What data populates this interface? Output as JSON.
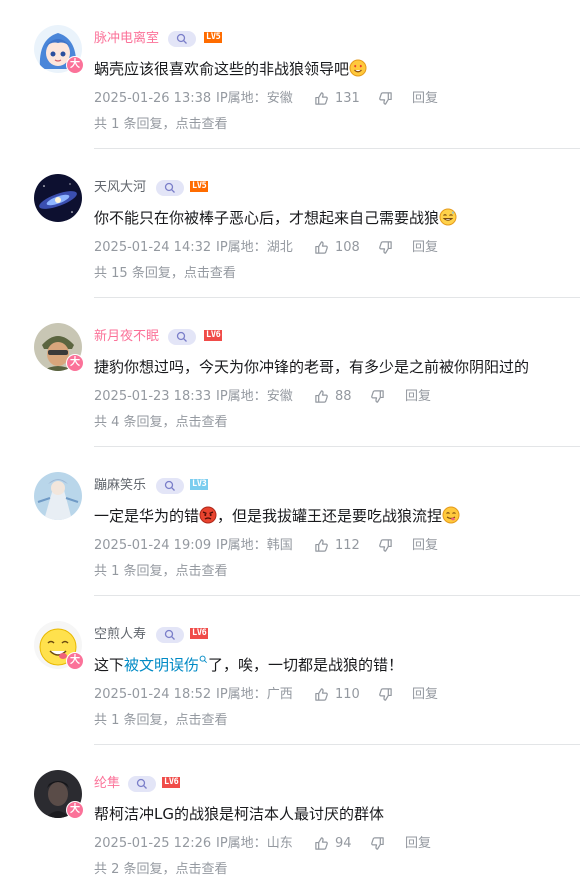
{
  "labels": {
    "ip_prefix": "IP属地：",
    "reply": "回复",
    "replies_prefix": "共 ",
    "replies_suffix": " 条回复，点击查看",
    "vip_badge": "大"
  },
  "comments": [
    {
      "username": "脉冲电离室",
      "level": "LV5",
      "text": "蜗壳应该很喜欢俞这些的非战狼领导吧",
      "emoji": "heart-eyes-emoji",
      "date": "2025-01-26 13:38",
      "ip": "安徽",
      "likes": "131",
      "reply_count": "1"
    },
    {
      "username": "天风大河",
      "level": "LV5",
      "text": "你不能只在你被棒子恶心后，才想起来自己需要战狼",
      "emoji": "sweat-smile-emoji",
      "date": "2025-01-24 14:32",
      "ip": "湖北",
      "likes": "108",
      "reply_count": "15"
    },
    {
      "username": "新月夜不眠",
      "level": "LV6",
      "text": "捷豹你想过吗，今天为你冲锋的老哥，有多少是之前被你阴阳过的",
      "date": "2025-01-23 18:33",
      "ip": "安徽",
      "likes": "88",
      "reply_count": "4"
    },
    {
      "username": "蹦麻笑乐",
      "level": "LV3",
      "text_before": "一定是华为的错",
      "text_after": "，但是我拔罐王还是要吃战狼流捏",
      "emoji_mid": "angry-emoji",
      "emoji": "yum-emoji",
      "date": "2025-01-24 19:09",
      "ip": "韩国",
      "likes": "112",
      "reply_count": "1"
    },
    {
      "username": "空煎人寿",
      "level": "LV6",
      "text_before": "这下",
      "link": "被文明误伤",
      "text_after": "了，唉，一切都是战狼的错！",
      "date": "2025-01-24 18:52",
      "ip": "广西",
      "likes": "110",
      "reply_count": "1"
    },
    {
      "username": "纶隼",
      "level": "LV6",
      "text": "帮柯洁冲LG的战狼是柯洁本人最讨厌的群体",
      "date": "2025-01-25 12:26",
      "ip": "山东",
      "likes": "94",
      "reply_count": "2"
    }
  ]
}
